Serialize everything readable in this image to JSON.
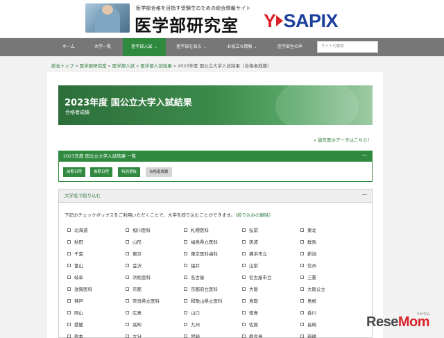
{
  "header": {
    "tagline": "医学部合格を目指す受験生のための総合情報サイト",
    "site_title": "医学部研究室",
    "sapix_y": "Y",
    "sapix_text": "SAPIX"
  },
  "nav": {
    "items": [
      {
        "label": "ホーム"
      },
      {
        "label": "大学一覧"
      },
      {
        "label": "医学部入試",
        "chevron": "⌄"
      },
      {
        "label": "医学部を知る",
        "chevron": "⌄"
      },
      {
        "label": "お役立ち情報",
        "chevron": "⌄"
      },
      {
        "label": "医学部生の声"
      }
    ],
    "search_placeholder": "サイト内検索"
  },
  "breadcrumb": {
    "items": [
      "総合トップ",
      "医学部研究室",
      "医学部入試",
      "医学部入試結果"
    ],
    "separator": " » ",
    "current": "2023年度 国公立大学入試結果（合格者成績）"
  },
  "banner": {
    "title": "2023年度 国公立大学入試結果",
    "subtitle": "合格者成績"
  },
  "past_link": "» 過年度のデータはこちら！",
  "results": {
    "heading": "2023年度 国公立大学入試結果 一覧",
    "collapse": "－",
    "buttons": [
      "前期日程",
      "後期日程",
      "特別選抜",
      "合格者成績"
    ]
  },
  "filter": {
    "heading": "大学名で絞り込む",
    "collapse": "－",
    "note": "下記のチェックボックスをご利用いただくことで、大学を絞り込むことができます。",
    "reset_link": "（絞り込みの解除）",
    "universities": [
      "北海道",
      "旭川医科",
      "札幌医科",
      "弘前",
      "東北",
      "秋田",
      "山形",
      "福島県立医科",
      "筑波",
      "群馬",
      "千葉",
      "東京",
      "東京医科歯科",
      "横浜市立",
      "新潟",
      "富山",
      "金沢",
      "福井",
      "山梨",
      "信州",
      "岐阜",
      "浜松医科",
      "名古屋",
      "名古屋市立",
      "三重",
      "滋賀医科",
      "京都",
      "京都府立医科",
      "大阪",
      "大阪公立",
      "神戸",
      "奈良県立医科",
      "和歌山県立医科",
      "鳥取",
      "島根",
      "岡山",
      "広島",
      "山口",
      "徳島",
      "香川",
      "愛媛",
      "高知",
      "九州",
      "佐賀",
      "長崎",
      "熊本",
      "大分",
      "宮崎",
      "鹿児島",
      "琉球"
    ]
  },
  "watermark": {
    "text_a": "Rese",
    "text_b": "Mom",
    "small": "リセマム"
  },
  "colors": {
    "accent": "#2f8a3f",
    "nav_bg": "#777777",
    "sapix_blue": "#1c3f9c",
    "sapix_red": "#d8232a"
  }
}
